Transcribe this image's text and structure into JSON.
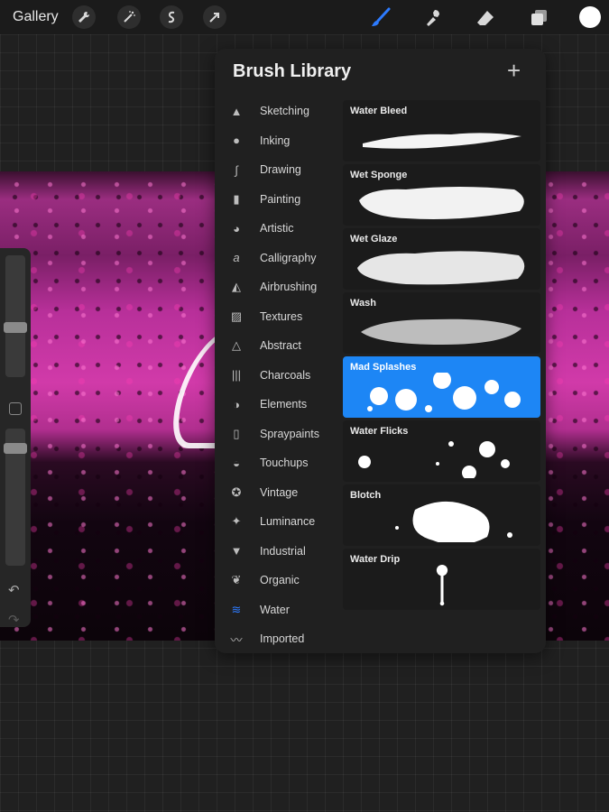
{
  "toolbar": {
    "gallery_label": "Gallery",
    "left_tools": [
      "wrench-icon",
      "magic-wand-icon",
      "selection-icon",
      "transform-arrow-icon"
    ],
    "right_tools": [
      "brush-icon",
      "smudge-icon",
      "eraser-icon",
      "layers-icon"
    ],
    "active_tool": "brush-icon",
    "accent_color": "#2d7bff",
    "current_color": "#ffffff"
  },
  "brush_library": {
    "title": "Brush Library",
    "add_symbol": "+",
    "categories": [
      {
        "label": "Sketching"
      },
      {
        "label": "Inking"
      },
      {
        "label": "Drawing"
      },
      {
        "label": "Painting"
      },
      {
        "label": "Artistic"
      },
      {
        "label": "Calligraphy"
      },
      {
        "label": "Airbrushing"
      },
      {
        "label": "Textures"
      },
      {
        "label": "Abstract"
      },
      {
        "label": "Charcoals"
      },
      {
        "label": "Elements"
      },
      {
        "label": "Spraypaints"
      },
      {
        "label": "Touchups"
      },
      {
        "label": "Vintage"
      },
      {
        "label": "Luminance"
      },
      {
        "label": "Industrial"
      },
      {
        "label": "Organic"
      },
      {
        "label": "Water"
      },
      {
        "label": "Imported"
      }
    ],
    "active_category": "Water",
    "brushes": [
      {
        "name": "Water Bleed"
      },
      {
        "name": "Wet Sponge"
      },
      {
        "name": "Wet Glaze"
      },
      {
        "name": "Wash"
      },
      {
        "name": "Mad Splashes"
      },
      {
        "name": "Water Flicks"
      },
      {
        "name": "Blotch"
      },
      {
        "name": "Water Drip"
      }
    ],
    "selected_brush": "Mad Splashes",
    "selected_color": "#1d86f5"
  },
  "sidebar": {
    "undo_symbol": "↶",
    "redo_symbol": "↷"
  }
}
